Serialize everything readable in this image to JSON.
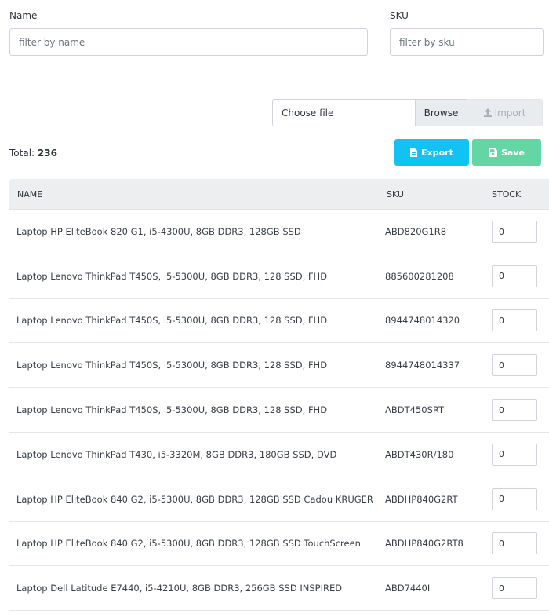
{
  "filters": {
    "name_label": "Name",
    "name_placeholder": "filter by name",
    "sku_label": "SKU",
    "sku_placeholder": "filter by sku"
  },
  "file_upload": {
    "choose_text": "Choose file",
    "browse_label": "Browse",
    "import_label": "Import",
    "import_icon": "upload-icon"
  },
  "summary": {
    "total_label": "Total:",
    "total_value": "236"
  },
  "actions": {
    "export_label": "Export",
    "export_icon": "file-icon",
    "save_label": "Save",
    "save_icon": "floppy-disk-icon"
  },
  "colors": {
    "export": "#12c2f2",
    "save": "#63d6a4",
    "header_bg": "#eceef0"
  },
  "table": {
    "columns": [
      "NAME",
      "SKU",
      "STOCK"
    ],
    "rows": [
      {
        "name": "Laptop HP EliteBook 820 G1, i5-4300U, 8GB DDR3, 128GB SSD",
        "sku": "ABD820G1R8",
        "stock": "0"
      },
      {
        "name": "Laptop Lenovo ThinkPad T450S, i5-5300U, 8GB DDR3, 128 SSD, FHD",
        "sku": "885600281208",
        "stock": "0"
      },
      {
        "name": "Laptop Lenovo ThinkPad T450S, i5-5300U, 8GB DDR3, 128 SSD, FHD",
        "sku": "8944748014320",
        "stock": "0"
      },
      {
        "name": "Laptop Lenovo ThinkPad T450S, i5-5300U, 8GB DDR3, 128 SSD, FHD",
        "sku": "8944748014337",
        "stock": "0"
      },
      {
        "name": "Laptop Lenovo ThinkPad T450S, i5-5300U, 8GB DDR3, 128 SSD, FHD",
        "sku": "ABDT450SRT",
        "stock": "0"
      },
      {
        "name": "Laptop Lenovo ThinkPad T430, i5-3320M, 8GB DDR3, 180GB SSD, DVD",
        "sku": "ABDT430R/180",
        "stock": "0"
      },
      {
        "name": "Laptop HP EliteBook 840 G2, i5-5300U, 8GB DDR3, 128GB SSD Cadou KRUGER",
        "sku": "ABDHP840G2RT",
        "stock": "0"
      },
      {
        "name": "Laptop HP EliteBook 840 G2, i5-5300U, 8GB DDR3, 128GB SSD TouchScreen",
        "sku": "ABDHP840G2RT8",
        "stock": "0"
      },
      {
        "name": "Laptop Dell Latitude E7440, i5-4210U, 8GB DDR3, 256GB SSD INSPIRED",
        "sku": "ABD7440I",
        "stock": "0"
      }
    ]
  }
}
